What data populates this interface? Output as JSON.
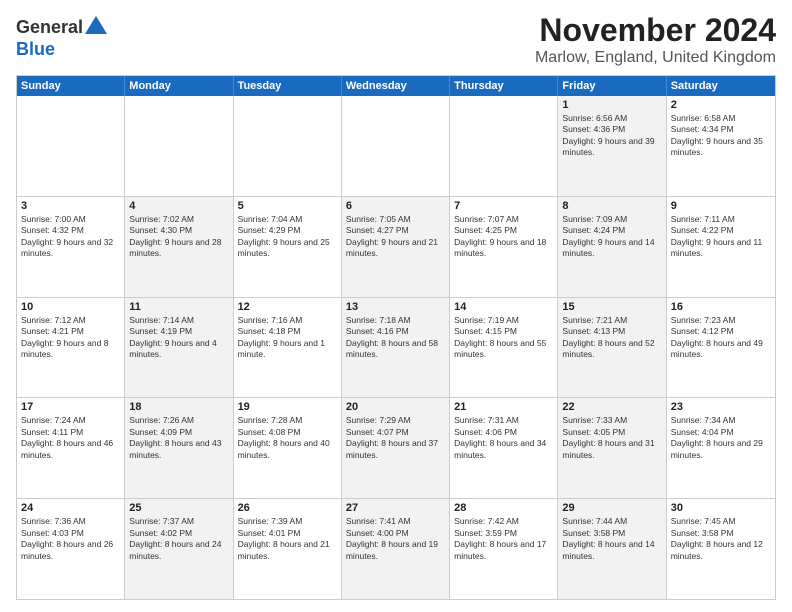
{
  "header": {
    "logo_general": "General",
    "logo_blue": "Blue",
    "main_title": "November 2024",
    "subtitle": "Marlow, England, United Kingdom"
  },
  "calendar": {
    "days_of_week": [
      "Sunday",
      "Monday",
      "Tuesday",
      "Wednesday",
      "Thursday",
      "Friday",
      "Saturday"
    ],
    "rows": [
      [
        {
          "day": "",
          "info": "",
          "shaded": false
        },
        {
          "day": "",
          "info": "",
          "shaded": false
        },
        {
          "day": "",
          "info": "",
          "shaded": false
        },
        {
          "day": "",
          "info": "",
          "shaded": false
        },
        {
          "day": "",
          "info": "",
          "shaded": false
        },
        {
          "day": "1",
          "info": "Sunrise: 6:56 AM\nSunset: 4:36 PM\nDaylight: 9 hours and 39 minutes.",
          "shaded": true
        },
        {
          "day": "2",
          "info": "Sunrise: 6:58 AM\nSunset: 4:34 PM\nDaylight: 9 hours and 35 minutes.",
          "shaded": false
        }
      ],
      [
        {
          "day": "3",
          "info": "Sunrise: 7:00 AM\nSunset: 4:32 PM\nDaylight: 9 hours and 32 minutes.",
          "shaded": false
        },
        {
          "day": "4",
          "info": "Sunrise: 7:02 AM\nSunset: 4:30 PM\nDaylight: 9 hours and 28 minutes.",
          "shaded": true
        },
        {
          "day": "5",
          "info": "Sunrise: 7:04 AM\nSunset: 4:29 PM\nDaylight: 9 hours and 25 minutes.",
          "shaded": false
        },
        {
          "day": "6",
          "info": "Sunrise: 7:05 AM\nSunset: 4:27 PM\nDaylight: 9 hours and 21 minutes.",
          "shaded": true
        },
        {
          "day": "7",
          "info": "Sunrise: 7:07 AM\nSunset: 4:25 PM\nDaylight: 9 hours and 18 minutes.",
          "shaded": false
        },
        {
          "day": "8",
          "info": "Sunrise: 7:09 AM\nSunset: 4:24 PM\nDaylight: 9 hours and 14 minutes.",
          "shaded": true
        },
        {
          "day": "9",
          "info": "Sunrise: 7:11 AM\nSunset: 4:22 PM\nDaylight: 9 hours and 11 minutes.",
          "shaded": false
        }
      ],
      [
        {
          "day": "10",
          "info": "Sunrise: 7:12 AM\nSunset: 4:21 PM\nDaylight: 9 hours and 8 minutes.",
          "shaded": false
        },
        {
          "day": "11",
          "info": "Sunrise: 7:14 AM\nSunset: 4:19 PM\nDaylight: 9 hours and 4 minutes.",
          "shaded": true
        },
        {
          "day": "12",
          "info": "Sunrise: 7:16 AM\nSunset: 4:18 PM\nDaylight: 9 hours and 1 minute.",
          "shaded": false
        },
        {
          "day": "13",
          "info": "Sunrise: 7:18 AM\nSunset: 4:16 PM\nDaylight: 8 hours and 58 minutes.",
          "shaded": true
        },
        {
          "day": "14",
          "info": "Sunrise: 7:19 AM\nSunset: 4:15 PM\nDaylight: 8 hours and 55 minutes.",
          "shaded": false
        },
        {
          "day": "15",
          "info": "Sunrise: 7:21 AM\nSunset: 4:13 PM\nDaylight: 8 hours and 52 minutes.",
          "shaded": true
        },
        {
          "day": "16",
          "info": "Sunrise: 7:23 AM\nSunset: 4:12 PM\nDaylight: 8 hours and 49 minutes.",
          "shaded": false
        }
      ],
      [
        {
          "day": "17",
          "info": "Sunrise: 7:24 AM\nSunset: 4:11 PM\nDaylight: 8 hours and 46 minutes.",
          "shaded": false
        },
        {
          "day": "18",
          "info": "Sunrise: 7:26 AM\nSunset: 4:09 PM\nDaylight: 8 hours and 43 minutes.",
          "shaded": true
        },
        {
          "day": "19",
          "info": "Sunrise: 7:28 AM\nSunset: 4:08 PM\nDaylight: 8 hours and 40 minutes.",
          "shaded": false
        },
        {
          "day": "20",
          "info": "Sunrise: 7:29 AM\nSunset: 4:07 PM\nDaylight: 8 hours and 37 minutes.",
          "shaded": true
        },
        {
          "day": "21",
          "info": "Sunrise: 7:31 AM\nSunset: 4:06 PM\nDaylight: 8 hours and 34 minutes.",
          "shaded": false
        },
        {
          "day": "22",
          "info": "Sunrise: 7:33 AM\nSunset: 4:05 PM\nDaylight: 8 hours and 31 minutes.",
          "shaded": true
        },
        {
          "day": "23",
          "info": "Sunrise: 7:34 AM\nSunset: 4:04 PM\nDaylight: 8 hours and 29 minutes.",
          "shaded": false
        }
      ],
      [
        {
          "day": "24",
          "info": "Sunrise: 7:36 AM\nSunset: 4:03 PM\nDaylight: 8 hours and 26 minutes.",
          "shaded": false
        },
        {
          "day": "25",
          "info": "Sunrise: 7:37 AM\nSunset: 4:02 PM\nDaylight: 8 hours and 24 minutes.",
          "shaded": true
        },
        {
          "day": "26",
          "info": "Sunrise: 7:39 AM\nSunset: 4:01 PM\nDaylight: 8 hours and 21 minutes.",
          "shaded": false
        },
        {
          "day": "27",
          "info": "Sunrise: 7:41 AM\nSunset: 4:00 PM\nDaylight: 8 hours and 19 minutes.",
          "shaded": true
        },
        {
          "day": "28",
          "info": "Sunrise: 7:42 AM\nSunset: 3:59 PM\nDaylight: 8 hours and 17 minutes.",
          "shaded": false
        },
        {
          "day": "29",
          "info": "Sunrise: 7:44 AM\nSunset: 3:58 PM\nDaylight: 8 hours and 14 minutes.",
          "shaded": true
        },
        {
          "day": "30",
          "info": "Sunrise: 7:45 AM\nSunset: 3:58 PM\nDaylight: 8 hours and 12 minutes.",
          "shaded": false
        }
      ]
    ]
  }
}
